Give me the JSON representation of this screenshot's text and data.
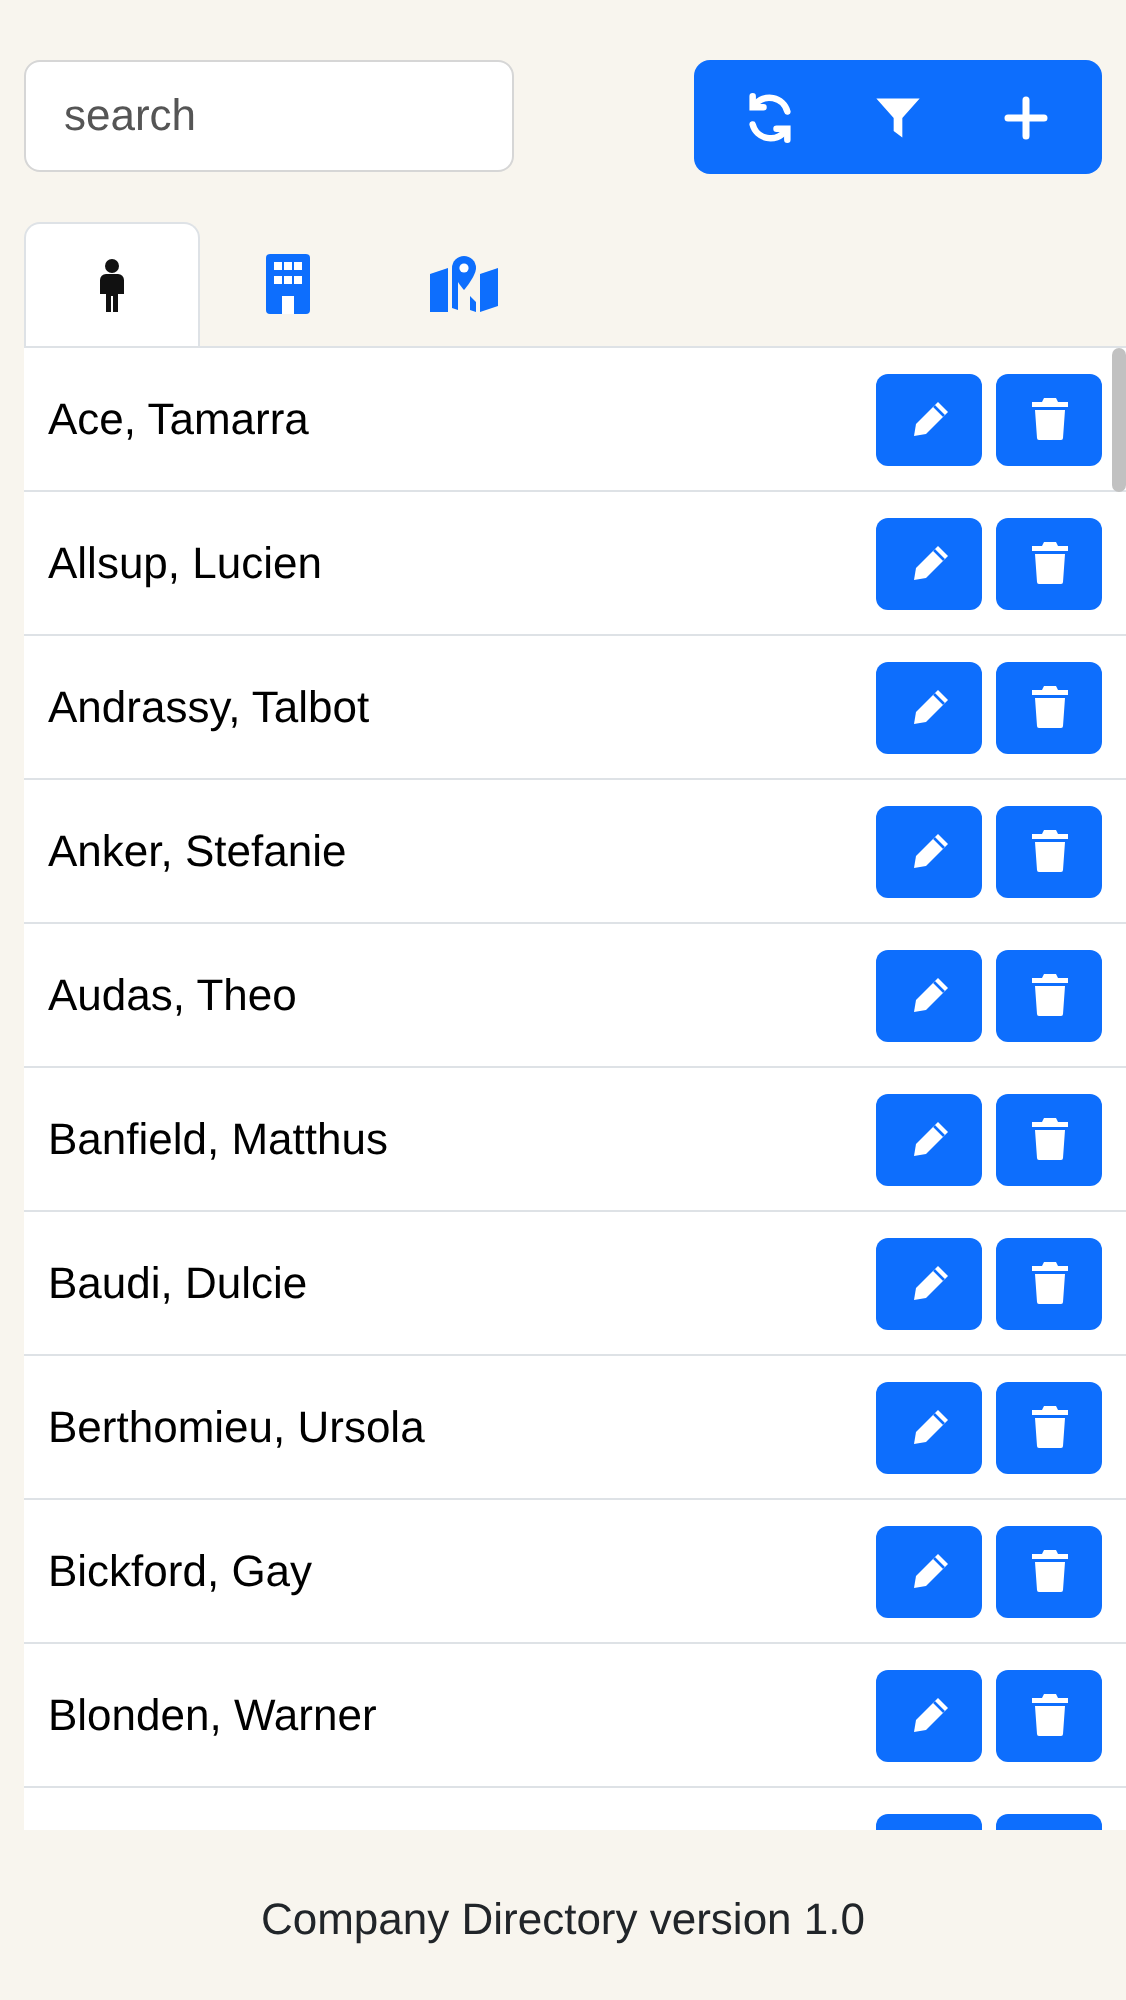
{
  "search": {
    "placeholder": "search"
  },
  "toolbar": [
    {
      "kind": "refresh"
    },
    {
      "kind": "filter"
    },
    {
      "kind": "add"
    }
  ],
  "tabs": [
    {
      "kind": "person",
      "selected": true
    },
    {
      "kind": "building",
      "selected": false
    },
    {
      "kind": "map",
      "selected": false
    }
  ],
  "rows": [
    {
      "name": "Ace, Tamarra"
    },
    {
      "name": "Allsup, Lucien"
    },
    {
      "name": "Andrassy, Talbot"
    },
    {
      "name": "Anker, Stefanie"
    },
    {
      "name": "Audas, Theo"
    },
    {
      "name": "Banfield, Matthus"
    },
    {
      "name": "Baudi, Dulcie"
    },
    {
      "name": "Berthomieu, Ursola"
    },
    {
      "name": "Bickford, Gay"
    },
    {
      "name": "Blonden, Warner"
    }
  ],
  "more_rows_below": true,
  "footer": "Company Directory version 1.0"
}
